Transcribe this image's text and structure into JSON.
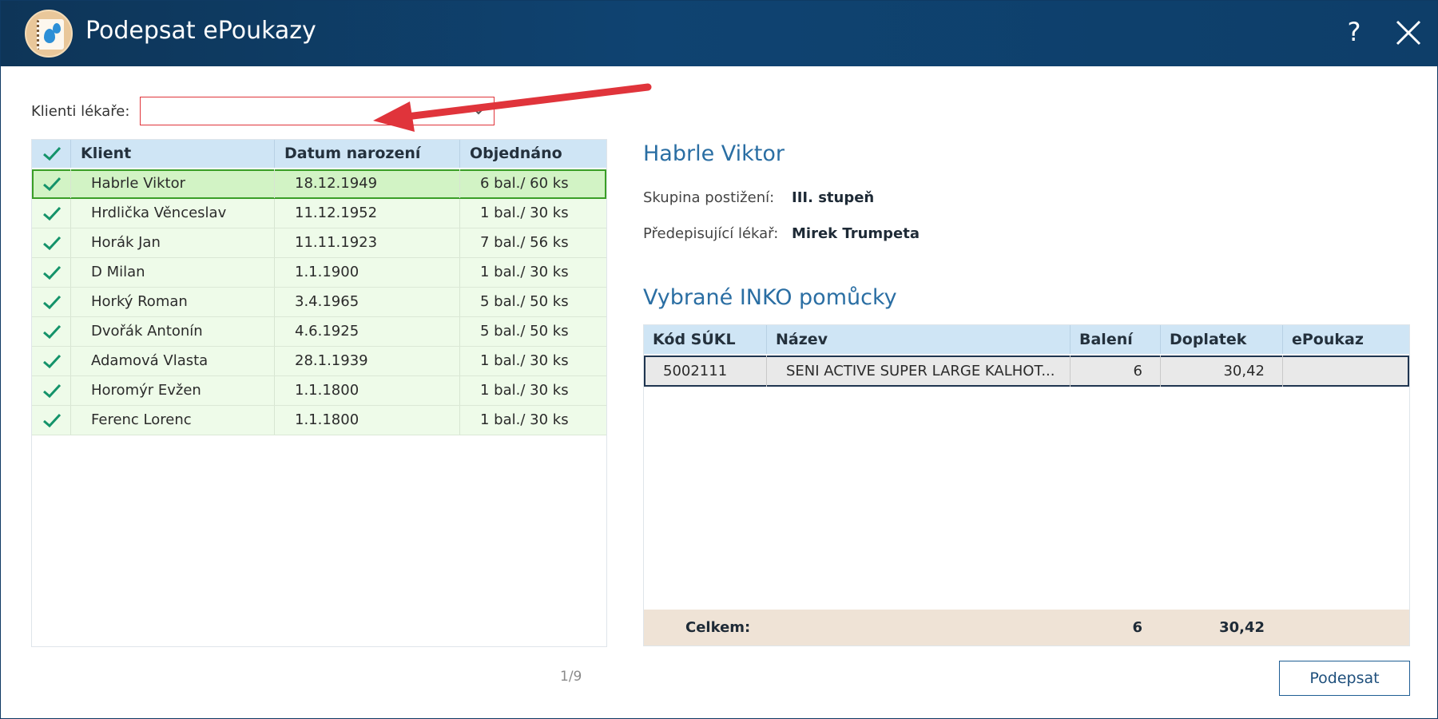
{
  "window": {
    "title": "Podepsat ePoukazy",
    "help_label": "?"
  },
  "filter": {
    "label": "Klienti lékaře:",
    "value": ""
  },
  "clients_table": {
    "headers": {
      "client": "Klient",
      "birth_date": "Datum narození",
      "ordered": "Objednáno"
    },
    "rows": [
      {
        "name": "Habrle Viktor",
        "birth_date": "18.12.1949",
        "ordered": "6 bal./ 60 ks"
      },
      {
        "name": "Hrdlička Věnceslav",
        "birth_date": "11.12.1952",
        "ordered": "1 bal./ 30 ks"
      },
      {
        "name": "Horák Jan",
        "birth_date": "11.11.1923",
        "ordered": "7 bal./ 56 ks"
      },
      {
        "name": "D Milan",
        "birth_date": "1.1.1900",
        "ordered": "1 bal./ 30 ks"
      },
      {
        "name": "Horký Roman",
        "birth_date": "3.4.1965",
        "ordered": "5 bal./ 50 ks"
      },
      {
        "name": "Dvořák Antonín",
        "birth_date": "4.6.1925",
        "ordered": "5 bal./ 50 ks"
      },
      {
        "name": "Adamová Vlasta",
        "birth_date": "28.1.1939",
        "ordered": "1 bal./ 30 ks"
      },
      {
        "name": "Horomýr Evžen",
        "birth_date": "1.1.1800",
        "ordered": "1 bal./ 30 ks"
      },
      {
        "name": "Ferenc Lorenc",
        "birth_date": "1.1.1800",
        "ordered": "1 bal./ 30 ks"
      }
    ],
    "pager": "1/9"
  },
  "detail": {
    "name": "Habrle Viktor",
    "disability_label": "Skupina postižení:",
    "disability_value": "III. stupeň",
    "doctor_label": "Předepisující lékař:",
    "doctor_value": "Mirek Trumpeta",
    "section_title": "Vybrané INKO pomůcky"
  },
  "aids_table": {
    "headers": {
      "code": "Kód SÚKL",
      "name": "Název",
      "packages": "Balení",
      "surcharge": "Doplatek",
      "epoukaz": "ePoukaz"
    },
    "rows": [
      {
        "code": "5002111",
        "name": "SENI ACTIVE SUPER LARGE KALHOT...",
        "packages": "6",
        "surcharge": "30,42",
        "epoukaz": ""
      }
    ],
    "footer": {
      "label": "Celkem:",
      "packages": "6",
      "surcharge": "30,42"
    }
  },
  "actions": {
    "sign_label": "Podepsat"
  },
  "colors": {
    "titlebar": "#0f4371",
    "accent": "#2a6ea3",
    "check": "#14936a",
    "selected_row": "#d2f3c5",
    "annotation_arrow": "#e0343b"
  }
}
